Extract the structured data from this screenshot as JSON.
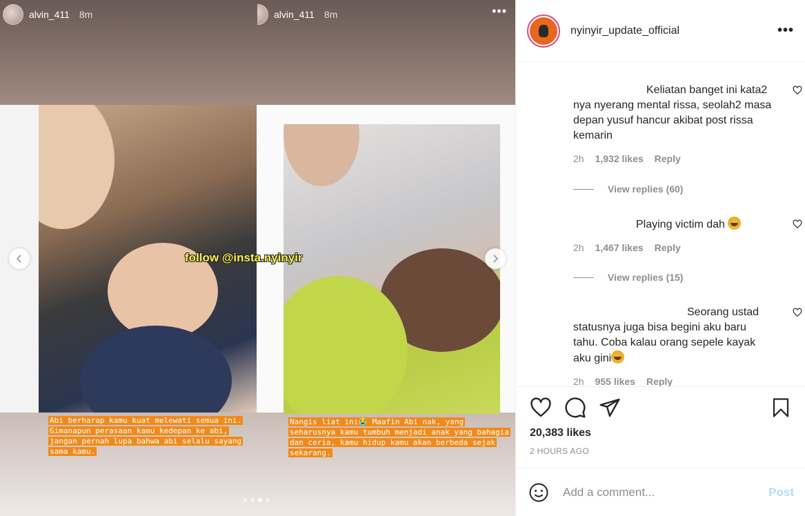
{
  "media": {
    "left_story": {
      "username": "alvin_411",
      "time": "8m",
      "overlay_text": "follow @insta.nyinyir",
      "caption": "Abi berharap kamu kuat melewati semua ini. Gimanapun perasaan kamu kedepan ke abi, jangan pernah lupa bahwa abi selalu sayang sama kamu."
    },
    "right_story": {
      "username": "alvin_411",
      "time": "8m",
      "more": "•••",
      "caption": "Nangis liat ini😭 Maafin Abi nak, yang seharusnya kamu tumbuh menjadi anak yang bahagia dan ceria, kamu hidup kamu akan berbeda sejak sekarang."
    },
    "prev_icon": "chevron-left-icon",
    "next_icon": "chevron-right-icon",
    "dots_count": 4,
    "active_dot": 3
  },
  "post": {
    "username": "nyinyir_update_official",
    "more": "•••"
  },
  "comments": [
    {
      "text": "Keliatan banget ini kata2 nya nyerang mental rissa, seolah2 masa depan yusuf hancur akibat post rissa kemarin",
      "time": "2h",
      "likes": "1,932 likes",
      "reply": "Reply",
      "view_replies": "View replies (60)"
    },
    {
      "text": "Playing victim dah",
      "time": "2h",
      "likes": "1,467 likes",
      "reply": "Reply",
      "view_replies": "View replies (15)"
    },
    {
      "text_a": "Seorang ustad statusnya juga bisa begini aku baru tahu. Coba kalau orang sepele kayak aku gini",
      "time": "2h",
      "likes": "955 likes",
      "reply": "Reply"
    }
  ],
  "actions": {
    "likes_total": "20,383 likes",
    "posted": "2 HOURS AGO"
  },
  "add_comment": {
    "placeholder": "Add a comment...",
    "post_label": "Post"
  },
  "colors": {
    "caption_bg": "#f08a1b",
    "post_button": "#b3dbff",
    "avatar_ring": "#e34a8c"
  }
}
